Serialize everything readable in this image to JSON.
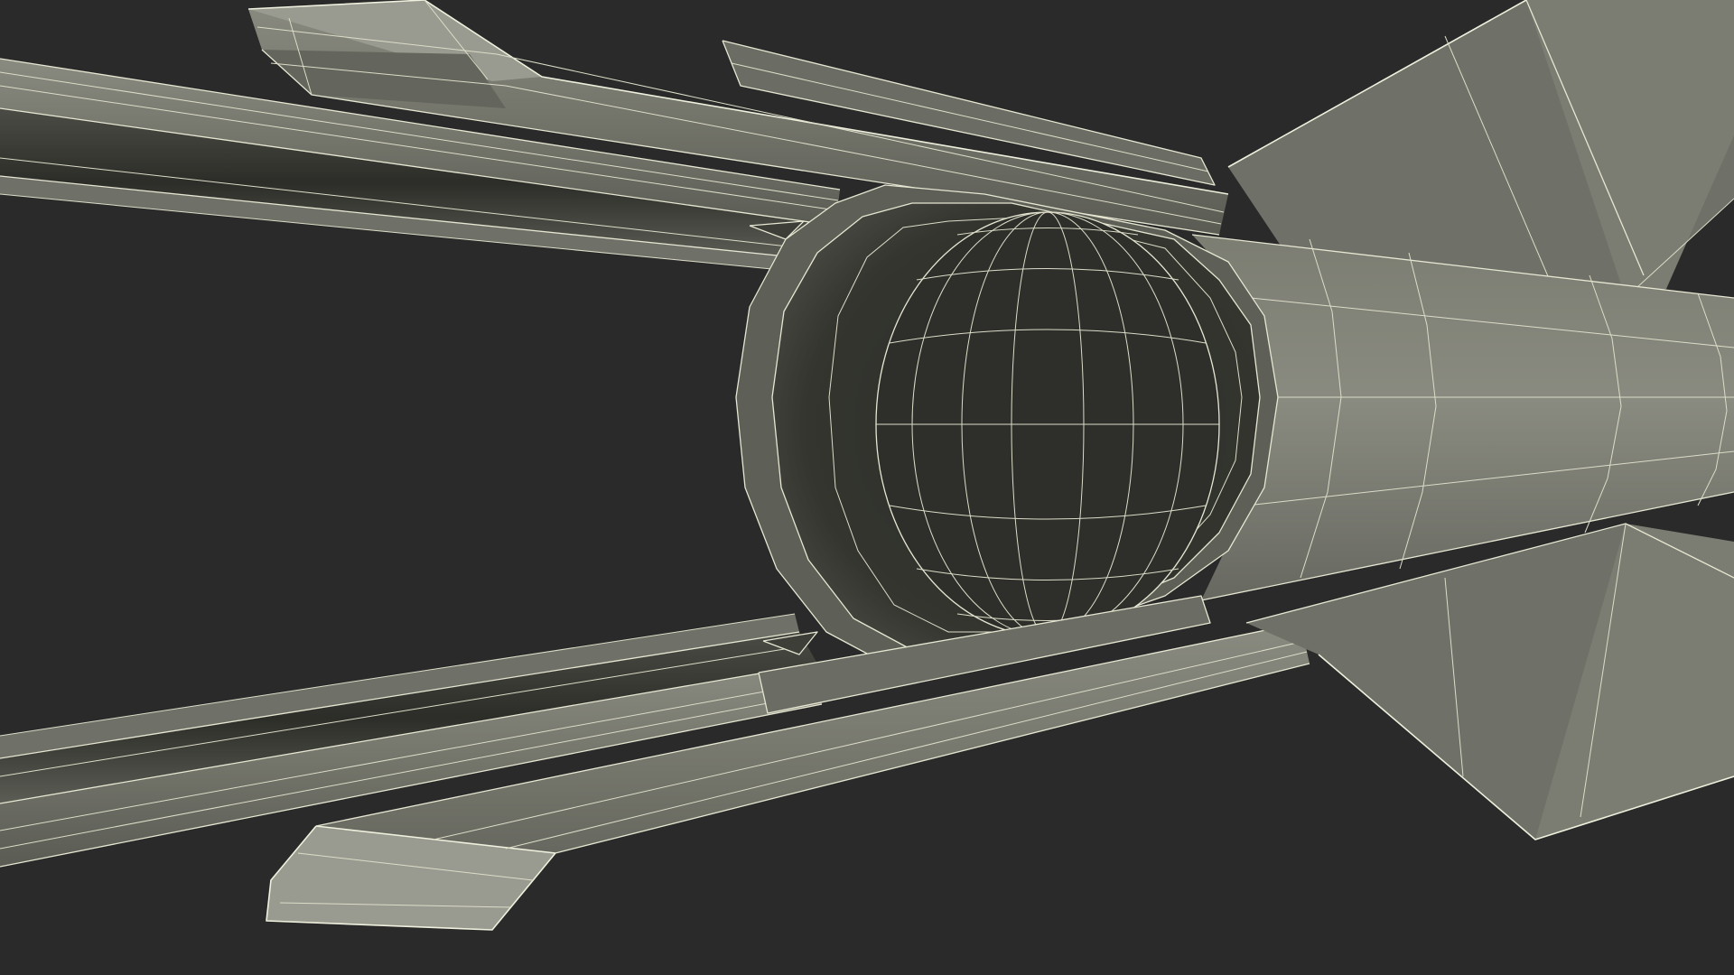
{
  "scene": {
    "subject": "rocket-engine-nozzle-wireframe",
    "colors": {
      "background": "#2a2a2a",
      "surface_light": "#85867a",
      "surface_mid": "#6e6f65",
      "surface_dark": "#55564e",
      "interior_dark": "#2f302b",
      "interior_mid": "#3a3b35",
      "wireframe": "#e6e6d2"
    },
    "icons": [
      "rocket-nozzle-icon",
      "fin-icon",
      "booster-tube-icon"
    ]
  }
}
